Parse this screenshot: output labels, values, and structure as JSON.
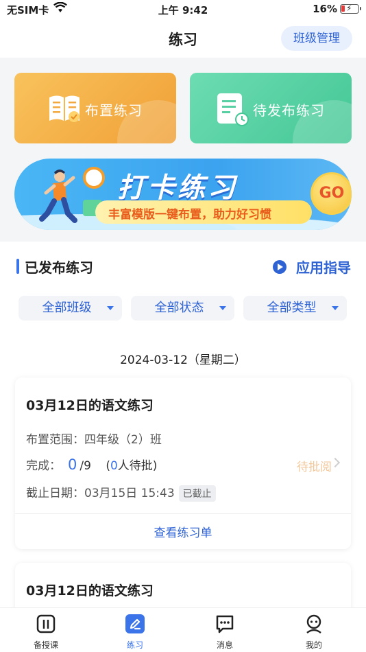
{
  "status_bar": {
    "carrier": "无SIM卡",
    "time": "上午 9:42",
    "battery": "16%"
  },
  "header": {
    "title": "练习",
    "class_mgmt_label": "班级管理"
  },
  "actions": {
    "assign_label": "布置练习",
    "pending_label": "待发布练习"
  },
  "banner": {
    "headline": "打卡练习",
    "subtitle": "丰富模版一键布置，助力好习惯",
    "go_label": "GO"
  },
  "published": {
    "section_title": "已发布练习",
    "guide_label": "应用指导",
    "filters": [
      "全部班级",
      "全部状态",
      "全部类型"
    ],
    "date_header": "2024-03-12（星期二）",
    "cards": [
      {
        "title": "03月12日的语文练习",
        "scope": "布置范围：四年级（2）班",
        "done_label": "完成：",
        "done_count": "0",
        "done_total": "/9",
        "pending_open": "(",
        "pending_count": "0",
        "pending_text": "人待批)",
        "review_label": "待批阅",
        "deadline": "截止日期：03月15日 15:43",
        "status_tag": "已截止",
        "view_label": "查看练习单"
      },
      {
        "title": "03月12日的语文练习"
      }
    ]
  },
  "tabs": [
    {
      "label": "备授课",
      "icon": "book-icon",
      "active": false
    },
    {
      "label": "练习",
      "icon": "pencil-icon",
      "active": true
    },
    {
      "label": "消息",
      "icon": "message-icon",
      "active": false
    },
    {
      "label": "我的",
      "icon": "profile-icon",
      "active": false
    }
  ],
  "colors": {
    "accent": "#3b73e8",
    "assign_card": "#f0a036",
    "pending_card": "#44c795"
  }
}
